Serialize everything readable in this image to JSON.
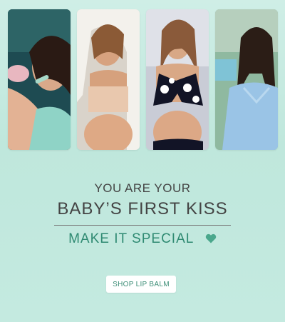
{
  "banner": {
    "photos": [
      {
        "icon": "photo-woman-with-baby"
      },
      {
        "icon": "photo-pregnant-woman-hood"
      },
      {
        "icon": "photo-pregnant-woman-polka-dot"
      },
      {
        "icon": "photo-pregnant-woman-blue-dress"
      }
    ],
    "headline_line1": "YOU ARE YOUR",
    "headline_line2": "BABY’S FIRST KISS",
    "tagline": "MAKE IT SPECIAL",
    "heart_icon": "heart-icon",
    "cta_label": "SHOP LIP BALM",
    "colors": {
      "background": "#c4eae0",
      "accent": "#2f8a72",
      "heading": "#444444"
    }
  }
}
